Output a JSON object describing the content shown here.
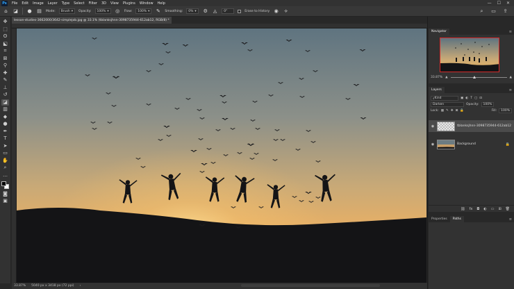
{
  "menubar": {
    "logo": "Ps",
    "items": [
      "File",
      "Edit",
      "Image",
      "Layer",
      "Type",
      "Select",
      "Filter",
      "3D",
      "View",
      "Plugins",
      "Window",
      "Help"
    ],
    "controls": [
      "—",
      "☐",
      "✕"
    ]
  },
  "options": {
    "mode_label": "Mode:",
    "mode_value": "Brush",
    "opacity_label": "Opacity:",
    "opacity_value": "100%",
    "flow_label": "Flow:",
    "flow_value": "100%",
    "smoothing_label": "Smoothing:",
    "smoothing_value": "0%",
    "angle_value": "0°",
    "erase_history_label": "Erase to History"
  },
  "document": {
    "tab_title": "lesson-studies-3662000/3642-simplejob.jpg @ 33.1% (tblanksjhnn-3098735944-612ab12, RGB/8) *",
    "close": "×"
  },
  "status": {
    "zoom": "33.87%",
    "size": "5040 px x 3418 px (72 ppi)"
  },
  "navigator": {
    "tab": "Navigator",
    "zoom": "33.87%"
  },
  "layers_panel": {
    "tab": "Layers",
    "kind_label": "Kind",
    "blend_mode": "Darken",
    "opacity_label": "Opacity:",
    "opacity_value": "100%",
    "lock_label": "Lock:",
    "fill_label": "Fill:",
    "fill_value": "100%",
    "layers": [
      {
        "name": "tblanksjhnn-3098735944-612ab12",
        "selected": true
      },
      {
        "name": "Background",
        "selected": false
      }
    ]
  },
  "bottom_panel": {
    "tabs": [
      "Properties",
      "Paths"
    ]
  },
  "colors": {
    "accent_red": "#d52929",
    "ui_dark": "#323232",
    "ps_blue": "#31a8ff"
  }
}
